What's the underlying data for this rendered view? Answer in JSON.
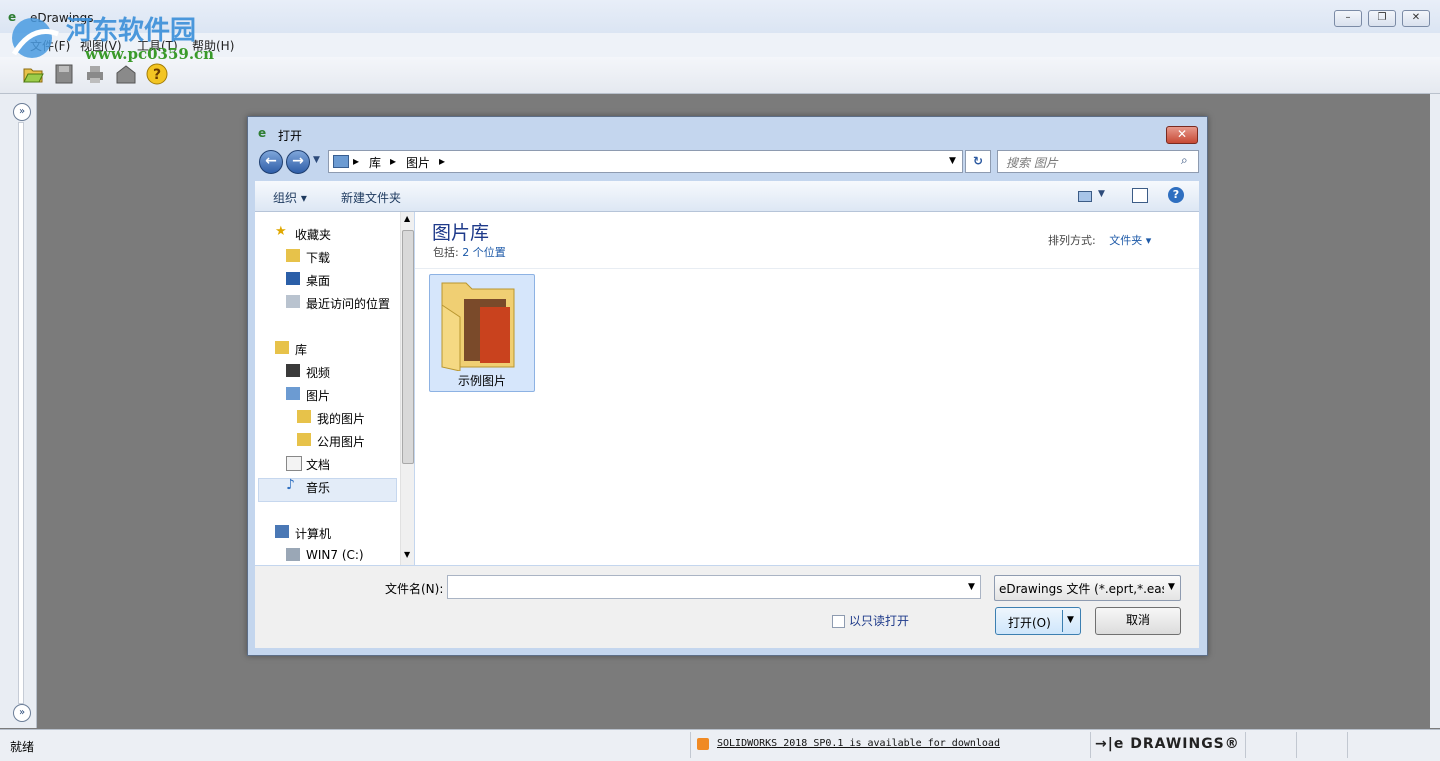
{
  "app": {
    "title": "eDrawings",
    "menu": [
      "文件(F)",
      "视图(V)",
      "工具(T)",
      "帮助(H)"
    ],
    "status": "就绪",
    "update_notice": "SOLIDWORKS 2018 SP0.1 is available for download",
    "brand": "→|e DRAWINGS®"
  },
  "watermark": {
    "line1": "河东软件园",
    "line2": "www.pc0359.cn"
  },
  "dialog": {
    "title": "打开",
    "breadcrumb": [
      "库",
      "图片"
    ],
    "search_placeholder": "搜索 图片",
    "commands": {
      "organize": "组织 ▾",
      "new_folder": "新建文件夹"
    },
    "nav": {
      "favorites": "收藏夹",
      "downloads": "下载",
      "desktop": "桌面",
      "recent": "最近访问的位置",
      "libraries": "库",
      "videos": "视频",
      "pictures": "图片",
      "my_pictures": "我的图片",
      "public_pictures": "公用图片",
      "documents": "文档",
      "music": "音乐",
      "computer": "计算机",
      "drive_c": "WIN7 (C:)"
    },
    "library_title": "图片库",
    "includes_label": "包括:",
    "includes_value": "2 个位置",
    "sort_label": "排列方式:",
    "sort_value": "文件夹 ▾",
    "items": [
      {
        "name": "示例图片"
      }
    ],
    "filename_label": "文件名(N):",
    "filename_value": "",
    "filter": "eDrawings 文件 (*.eprt,*.easr",
    "readonly_label": "以只读打开",
    "open_label": "打开(O)",
    "cancel_label": "取消"
  }
}
